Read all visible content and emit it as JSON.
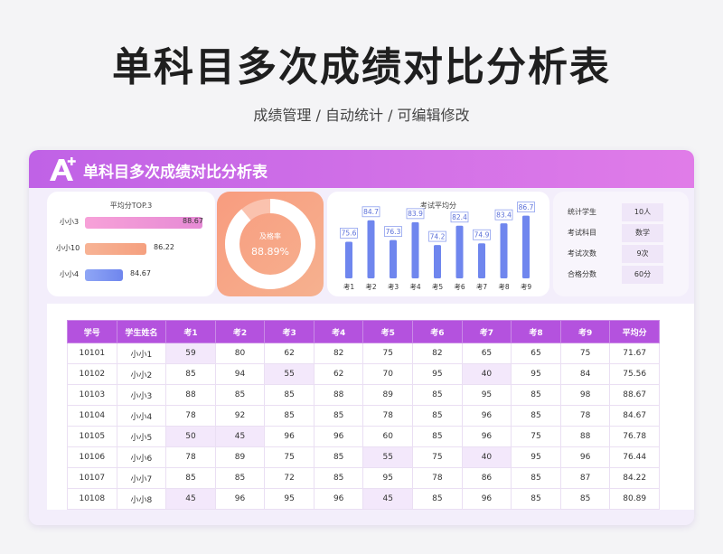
{
  "page": {
    "title": "单科目多次成绩对比分析表",
    "subtitle": "成绩管理 /  自动统计  /  可编辑修改"
  },
  "card": {
    "title": "单科目多次成绩对比分析表",
    "logo_text": "A+"
  },
  "top3": {
    "title": "平均分TOP.3",
    "items": [
      {
        "name": "小小3",
        "value": "88.67"
      },
      {
        "name": "小小10",
        "value": "86.22"
      },
      {
        "name": "小小4",
        "value": "84.67"
      }
    ]
  },
  "pass_rate": {
    "label": "及格率",
    "value": "88.89%",
    "fraction": 0.8889
  },
  "chart_data": {
    "type": "bar",
    "title": "考试平均分",
    "categories": [
      "考1",
      "考2",
      "考3",
      "考4",
      "考5",
      "考6",
      "考7",
      "考8",
      "考9"
    ],
    "values": [
      75.6,
      84.7,
      76.3,
      83.9,
      74.2,
      82.4,
      74.9,
      83.4,
      86.7
    ]
  },
  "stats": [
    {
      "key": "统计学生",
      "value": "10人"
    },
    {
      "key": "考试科目",
      "value": "数学"
    },
    {
      "key": "考试次数",
      "value": "9次"
    },
    {
      "key": "合格分数",
      "value": "60分"
    }
  ],
  "table": {
    "headers": [
      "学号",
      "学生姓名",
      "考1",
      "考2",
      "考3",
      "考4",
      "考5",
      "考6",
      "考7",
      "考8",
      "考9",
      "平均分"
    ],
    "rows": [
      [
        "10101",
        "小小1",
        "59",
        "80",
        "62",
        "82",
        "75",
        "82",
        "65",
        "65",
        "75",
        "71.67"
      ],
      [
        "10102",
        "小小2",
        "85",
        "94",
        "55",
        "62",
        "70",
        "95",
        "40",
        "95",
        "84",
        "75.56"
      ],
      [
        "10103",
        "小小3",
        "88",
        "85",
        "85",
        "88",
        "89",
        "85",
        "95",
        "85",
        "98",
        "88.67"
      ],
      [
        "10104",
        "小小4",
        "78",
        "92",
        "85",
        "85",
        "78",
        "85",
        "96",
        "85",
        "78",
        "84.67"
      ],
      [
        "10105",
        "小小5",
        "50",
        "45",
        "96",
        "96",
        "60",
        "85",
        "96",
        "75",
        "88",
        "76.78"
      ],
      [
        "10106",
        "小小6",
        "78",
        "89",
        "75",
        "85",
        "55",
        "75",
        "40",
        "95",
        "96",
        "76.44"
      ],
      [
        "10107",
        "小小7",
        "85",
        "85",
        "72",
        "85",
        "95",
        "78",
        "86",
        "85",
        "87",
        "84.22"
      ],
      [
        "10108",
        "小小8",
        "45",
        "96",
        "95",
        "96",
        "45",
        "85",
        "96",
        "85",
        "85",
        "80.89"
      ]
    ]
  },
  "colors": {
    "accent": "#b452de",
    "header_gradient_start": "#c062e6",
    "header_gradient_end": "#e07ce8",
    "bar_blue": "#6f86ee",
    "pass_orange": "#f89c7f"
  }
}
